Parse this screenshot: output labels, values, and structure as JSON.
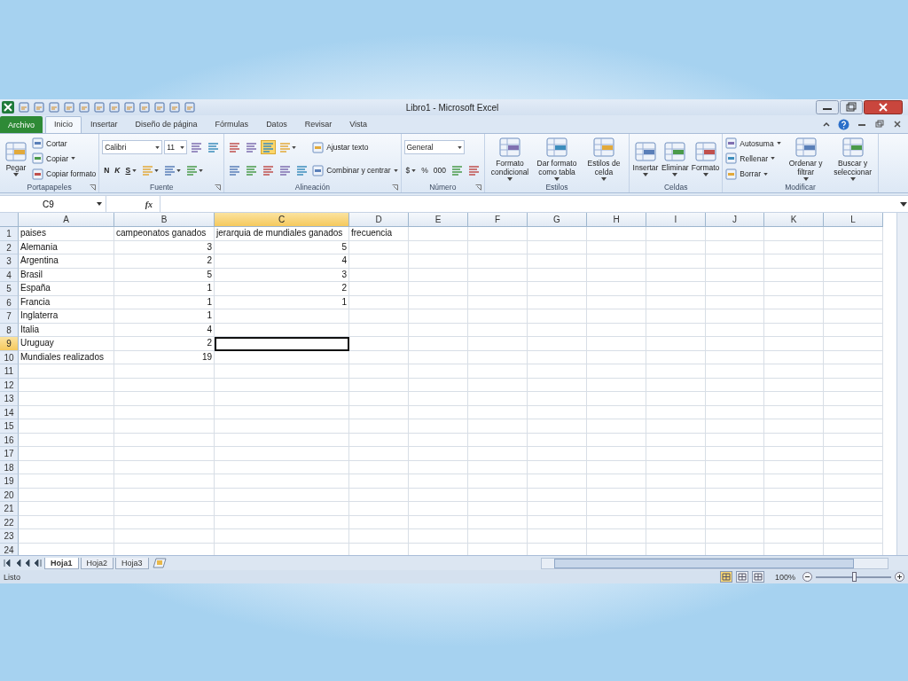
{
  "window": {
    "title": "Libro1 - Microsoft Excel"
  },
  "tabs": [
    {
      "label": "Archivo",
      "kind": "file",
      "selected": false
    },
    {
      "label": "Inicio",
      "kind": "tab",
      "selected": true
    },
    {
      "label": "Insertar",
      "kind": "tab",
      "selected": false
    },
    {
      "label": "Diseño de página",
      "kind": "tab",
      "selected": false
    },
    {
      "label": "Fórmulas",
      "kind": "tab",
      "selected": false
    },
    {
      "label": "Datos",
      "kind": "tab",
      "selected": false
    },
    {
      "label": "Revisar",
      "kind": "tab",
      "selected": false
    },
    {
      "label": "Vista",
      "kind": "tab",
      "selected": false
    }
  ],
  "ribbon": {
    "groups": [
      {
        "label": "Portapapeles",
        "launcher": true,
        "columns": [
          {
            "lines": [
              {
                "tools": [
                  {
                    "kind": "large",
                    "label": "Pegar",
                    "dropdown": true
                  }
                ]
              }
            ]
          },
          {
            "lines": [
              {
                "tools": [
                  {
                    "kind": "small",
                    "label": "Cortar"
                  }
                ]
              },
              {
                "tools": [
                  {
                    "kind": "small",
                    "label": "Copiar",
                    "dropdown": true
                  }
                ]
              },
              {
                "tools": [
                  {
                    "kind": "small",
                    "label": "Copiar formato"
                  }
                ]
              }
            ]
          }
        ]
      },
      {
        "label": "Fuente",
        "launcher": true,
        "columns": [
          {
            "lines": [
              {
                "tools": [
                  {
                    "kind": "field",
                    "label": "Calibri",
                    "dropdown": true
                  },
                  {
                    "kind": "field",
                    "label": "11",
                    "dropdown": true
                  },
                  {
                    "kind": "icon"
                  },
                  {
                    "kind": "icon"
                  }
                ]
              },
              {
                "tools": [
                  {
                    "kind": "bold",
                    "label": "N"
                  },
                  {
                    "kind": "italic",
                    "label": "K"
                  },
                  {
                    "kind": "underline",
                    "label": "S",
                    "dropdown": true
                  },
                  {
                    "kind": "icon",
                    "dropdown": true
                  },
                  {
                    "kind": "icon",
                    "dropdown": true
                  },
                  {
                    "kind": "icon",
                    "dropdown": true
                  }
                ]
              }
            ]
          }
        ]
      },
      {
        "label": "Alineación",
        "launcher": true,
        "columns": [
          {
            "lines": [
              {
                "tools": [
                  {
                    "kind": "icon",
                    "selected": false
                  },
                  {
                    "kind": "icon",
                    "selected": false
                  },
                  {
                    "kind": "icon",
                    "selected": true
                  },
                  {
                    "kind": "icon",
                    "dropdown": true
                  }
                ]
              },
              {
                "tools": [
                  {
                    "kind": "icon"
                  },
                  {
                    "kind": "icon"
                  },
                  {
                    "kind": "icon"
                  },
                  {
                    "kind": "icon"
                  },
                  {
                    "kind": "icon"
                  }
                ]
              }
            ]
          },
          {
            "lines": [
              {
                "tools": [
                  {
                    "kind": "small",
                    "label": "Ajustar texto"
                  }
                ]
              },
              {
                "tools": [
                  {
                    "kind": "small",
                    "label": "Combinar y centrar",
                    "dropdown": true
                  }
                ]
              }
            ]
          }
        ]
      },
      {
        "label": "Número",
        "launcher": true,
        "columns": [
          {
            "lines": [
              {
                "tools": [
                  {
                    "kind": "field",
                    "label": "General",
                    "dropdown": true
                  }
                ]
              },
              {
                "tools": [
                  {
                    "kind": "glyph",
                    "label": "$",
                    "dropdown": true
                  },
                  {
                    "kind": "glyph",
                    "label": "%"
                  },
                  {
                    "kind": "glyph",
                    "label": "000"
                  },
                  {
                    "kind": "icon"
                  },
                  {
                    "kind": "icon"
                  }
                ]
              }
            ]
          }
        ]
      },
      {
        "label": "Estilos",
        "columns": [
          {
            "lines": [
              {
                "tools": [
                  {
                    "kind": "large",
                    "label": "Formato condicional",
                    "dropdown": true
                  }
                ]
              }
            ]
          },
          {
            "lines": [
              {
                "tools": [
                  {
                    "kind": "large",
                    "label": "Dar formato como tabla",
                    "dropdown": true
                  }
                ]
              }
            ]
          },
          {
            "lines": [
              {
                "tools": [
                  {
                    "kind": "large",
                    "label": "Estilos de celda",
                    "dropdown": true
                  }
                ]
              }
            ]
          }
        ]
      },
      {
        "label": "Celdas",
        "columns": [
          {
            "lines": [
              {
                "tools": [
                  {
                    "kind": "large",
                    "label": "Insertar",
                    "dropdown": true
                  }
                ]
              }
            ]
          },
          {
            "lines": [
              {
                "tools": [
                  {
                    "kind": "large",
                    "label": "Eliminar",
                    "dropdown": true
                  }
                ]
              }
            ]
          },
          {
            "lines": [
              {
                "tools": [
                  {
                    "kind": "large",
                    "label": "Formato",
                    "dropdown": true
                  }
                ]
              }
            ]
          }
        ]
      },
      {
        "label": "Modificar",
        "columns": [
          {
            "lines": [
              {
                "tools": [
                  {
                    "kind": "small",
                    "label": "Autosuma",
                    "dropdown": true
                  }
                ]
              },
              {
                "tools": [
                  {
                    "kind": "small",
                    "label": "Rellenar",
                    "dropdown": true
                  }
                ]
              },
              {
                "tools": [
                  {
                    "kind": "small",
                    "label": "Borrar",
                    "dropdown": true
                  }
                ]
              }
            ]
          },
          {
            "lines": [
              {
                "tools": [
                  {
                    "kind": "large",
                    "label": "Ordenar y filtrar",
                    "dropdown": true
                  }
                ]
              }
            ]
          },
          {
            "lines": [
              {
                "tools": [
                  {
                    "kind": "large",
                    "label": "Buscar y seleccionar",
                    "dropdown": true
                  }
                ]
              }
            ]
          }
        ]
      }
    ]
  },
  "formula_bar": {
    "name_box": "C9",
    "function_label": "fx"
  },
  "sheet": {
    "columns": [
      {
        "label": "A",
        "selected": false
      },
      {
        "label": "B",
        "selected": false
      },
      {
        "label": "C",
        "selected": true
      },
      {
        "label": "D",
        "selected": false
      },
      {
        "label": "E",
        "selected": false
      },
      {
        "label": "F",
        "selected": false
      },
      {
        "label": "G",
        "selected": false
      },
      {
        "label": "H",
        "selected": false
      },
      {
        "label": "I",
        "selected": false
      },
      {
        "label": "J",
        "selected": false
      },
      {
        "label": "K",
        "selected": false
      },
      {
        "label": "L",
        "selected": false
      }
    ],
    "rows": [
      {
        "number": "1",
        "selected": false,
        "cells": [
          {
            "text": "paises",
            "kind": "text"
          },
          {
            "text": "campeonatos ganados",
            "kind": "text"
          },
          {
            "text": "jerarquia de mundiales ganados",
            "kind": "text"
          },
          {
            "text": "frecuencia",
            "kind": "text"
          }
        ]
      },
      {
        "number": "2",
        "selected": false,
        "cells": [
          {
            "text": "Alemania",
            "kind": "text"
          },
          {
            "text": "3",
            "kind": "number"
          },
          {
            "text": "5",
            "kind": "number"
          }
        ]
      },
      {
        "number": "3",
        "selected": false,
        "cells": [
          {
            "text": "Argentina",
            "kind": "text"
          },
          {
            "text": "2",
            "kind": "number"
          },
          {
            "text": "4",
            "kind": "number"
          }
        ]
      },
      {
        "number": "4",
        "selected": false,
        "cells": [
          {
            "text": "Brasil",
            "kind": "text"
          },
          {
            "text": "5",
            "kind": "number"
          },
          {
            "text": "3",
            "kind": "number"
          }
        ]
      },
      {
        "number": "5",
        "selected": false,
        "cells": [
          {
            "text": "España",
            "kind": "text"
          },
          {
            "text": "1",
            "kind": "number"
          },
          {
            "text": "2",
            "kind": "number"
          }
        ]
      },
      {
        "number": "6",
        "selected": false,
        "cells": [
          {
            "text": "Francia",
            "kind": "text"
          },
          {
            "text": "1",
            "kind": "number"
          },
          {
            "text": "1",
            "kind": "number"
          }
        ]
      },
      {
        "number": "7",
        "selected": false,
        "cells": [
          {
            "text": "Inglaterra",
            "kind": "text"
          },
          {
            "text": "1",
            "kind": "number"
          }
        ]
      },
      {
        "number": "8",
        "selected": false,
        "cells": [
          {
            "text": "Italia",
            "kind": "text"
          },
          {
            "text": "4",
            "kind": "number"
          }
        ]
      },
      {
        "number": "9",
        "selected": true,
        "cells": [
          {
            "text": "Uruguay",
            "kind": "text"
          },
          {
            "text": "2",
            "kind": "number"
          }
        ]
      },
      {
        "number": "10",
        "selected": false,
        "cells": [
          {
            "text": "Mundiales realizados",
            "kind": "text"
          },
          {
            "text": "19",
            "kind": "number"
          }
        ]
      },
      {
        "number": "11",
        "selected": false
      },
      {
        "number": "12",
        "selected": false
      },
      {
        "number": "13",
        "selected": false
      },
      {
        "number": "14",
        "selected": false
      },
      {
        "number": "15",
        "selected": false
      },
      {
        "number": "16",
        "selected": false
      },
      {
        "number": "17",
        "selected": false
      },
      {
        "number": "18",
        "selected": false
      },
      {
        "number": "19",
        "selected": false
      },
      {
        "number": "20",
        "selected": false
      },
      {
        "number": "21",
        "selected": false
      },
      {
        "number": "22",
        "selected": false
      },
      {
        "number": "23",
        "selected": false
      },
      {
        "number": "24",
        "selected": false
      }
    ]
  },
  "sheet_tabs": [
    {
      "label": "Hoja1",
      "selected": true
    },
    {
      "label": "Hoja2",
      "selected": false
    },
    {
      "label": "Hoja3",
      "selected": false
    }
  ],
  "status_bar": {
    "text": "Listo",
    "views": [
      {
        "selected": true
      },
      {
        "selected": false
      },
      {
        "selected": false
      }
    ],
    "zoom": "100%",
    "zoom_slider": {
      "level": 0.5
    }
  }
}
